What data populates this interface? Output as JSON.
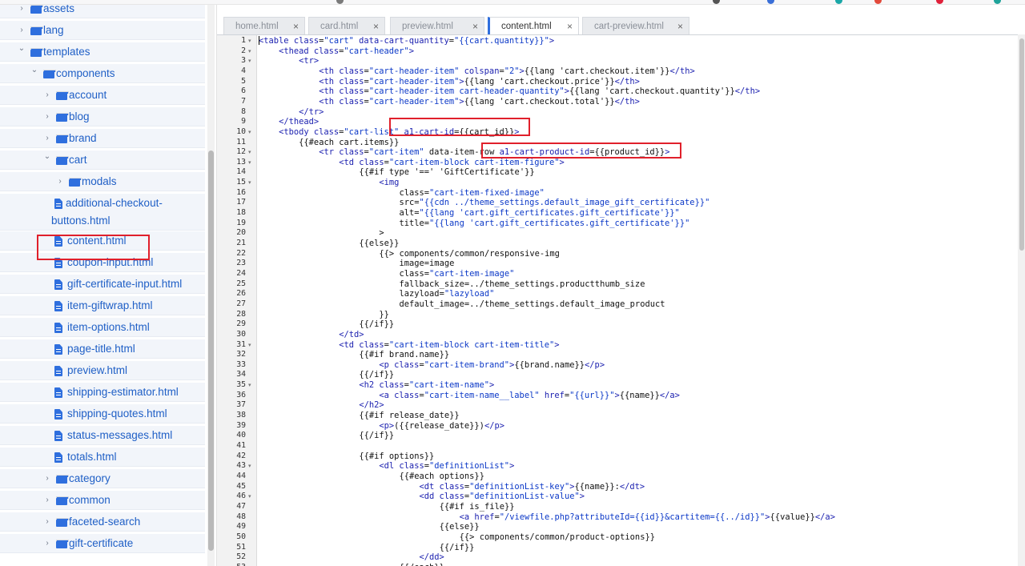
{
  "sidebar": {
    "items": [
      {
        "kind": "folder",
        "label": "assets",
        "expanded": false
      },
      {
        "kind": "folder",
        "label": "lang",
        "expanded": false
      },
      {
        "kind": "folder",
        "label": "templates",
        "expanded": true
      },
      {
        "kind": "folder",
        "label": "components",
        "expanded": true
      },
      {
        "kind": "folder",
        "label": "account",
        "expanded": false
      },
      {
        "kind": "folder",
        "label": "blog",
        "expanded": false
      },
      {
        "kind": "folder",
        "label": "brand",
        "expanded": false
      },
      {
        "kind": "folder",
        "label": "cart",
        "expanded": true
      },
      {
        "kind": "folder",
        "label": "modals",
        "expanded": false
      },
      {
        "kind": "file",
        "label": "additional-checkout-buttons.html"
      },
      {
        "kind": "file",
        "label": "content.html",
        "highlighted": true
      },
      {
        "kind": "file",
        "label": "coupon-input.html"
      },
      {
        "kind": "file",
        "label": "gift-certificate-input.html"
      },
      {
        "kind": "file",
        "label": "item-giftwrap.html"
      },
      {
        "kind": "file",
        "label": "item-options.html"
      },
      {
        "kind": "file",
        "label": "page-title.html"
      },
      {
        "kind": "file",
        "label": "preview.html"
      },
      {
        "kind": "file",
        "label": "shipping-estimator.html"
      },
      {
        "kind": "file",
        "label": "shipping-quotes.html"
      },
      {
        "kind": "file",
        "label": "status-messages.html"
      },
      {
        "kind": "file",
        "label": "totals.html"
      },
      {
        "kind": "folder",
        "label": "category",
        "expanded": false
      },
      {
        "kind": "folder",
        "label": "common",
        "expanded": false
      },
      {
        "kind": "folder",
        "label": "faceted-search",
        "expanded": false
      },
      {
        "kind": "folder",
        "label": "gift-certificate",
        "expanded": false
      }
    ]
  },
  "tabs": [
    {
      "label": "home.html",
      "active": false
    },
    {
      "label": "card.html",
      "active": false
    },
    {
      "label": "preview.html",
      "active": false
    },
    {
      "label": "content.html",
      "active": true
    },
    {
      "label": "cart-preview.html",
      "active": false
    }
  ],
  "tab_close_glyph": "×",
  "editor": {
    "lines": [
      {
        "n": "1",
        "fold": true,
        "text": "<table class=\"cart\" data-cart-quantity=\"{{cart.quantity}}\">"
      },
      {
        "n": "2",
        "fold": true,
        "text": "    <thead class=\"cart-header\">"
      },
      {
        "n": "3",
        "fold": true,
        "text": "        <tr>"
      },
      {
        "n": "4",
        "fold": false,
        "text": "            <th class=\"cart-header-item\" colspan=\"2\">{{lang 'cart.checkout.item'}}</th>"
      },
      {
        "n": "5",
        "fold": false,
        "text": "            <th class=\"cart-header-item\">{{lang 'cart.checkout.price'}}</th>"
      },
      {
        "n": "6",
        "fold": false,
        "text": "            <th class=\"cart-header-item cart-header-quantity\">{{lang 'cart.checkout.quantity'}}</th>"
      },
      {
        "n": "7",
        "fold": false,
        "text": "            <th class=\"cart-header-item\">{{lang 'cart.checkout.total'}}</th>"
      },
      {
        "n": "8",
        "fold": false,
        "text": "        </tr>"
      },
      {
        "n": "9",
        "fold": false,
        "text": "    </thead>"
      },
      {
        "n": "10",
        "fold": true,
        "text": "    <tbody class=\"cart-list\" a1-cart-id={{cart_id}}>"
      },
      {
        "n": "11",
        "fold": false,
        "text": "        {{#each cart.items}}"
      },
      {
        "n": "12",
        "fold": true,
        "text": "            <tr class=\"cart-item\" data-item-row a1-cart-product-id={{product_id}}>"
      },
      {
        "n": "13",
        "fold": true,
        "text": "                <td class=\"cart-item-block cart-item-figure\">"
      },
      {
        "n": "14",
        "fold": false,
        "text": "                    {{#if type '==' 'GiftCertificate'}}"
      },
      {
        "n": "15",
        "fold": true,
        "text": "                        <img"
      },
      {
        "n": "16",
        "fold": false,
        "text": "                            class=\"cart-item-fixed-image\""
      },
      {
        "n": "17",
        "fold": false,
        "text": "                            src=\"{{cdn ../theme_settings.default_image_gift_certificate}}\""
      },
      {
        "n": "18",
        "fold": false,
        "text": "                            alt=\"{{lang 'cart.gift_certificates.gift_certificate'}}\""
      },
      {
        "n": "19",
        "fold": false,
        "text": "                            title=\"{{lang 'cart.gift_certificates.gift_certificate'}}\""
      },
      {
        "n": "20",
        "fold": false,
        "text": "                        >"
      },
      {
        "n": "21",
        "fold": false,
        "text": "                    {{else}}"
      },
      {
        "n": "22",
        "fold": false,
        "text": "                        {{> components/common/responsive-img"
      },
      {
        "n": "23",
        "fold": false,
        "text": "                            image=image"
      },
      {
        "n": "24",
        "fold": false,
        "text": "                            class=\"cart-item-image\""
      },
      {
        "n": "25",
        "fold": false,
        "text": "                            fallback_size=../theme_settings.productthumb_size"
      },
      {
        "n": "26",
        "fold": false,
        "text": "                            lazyload=\"lazyload\""
      },
      {
        "n": "27",
        "fold": false,
        "text": "                            default_image=../theme_settings.default_image_product"
      },
      {
        "n": "28",
        "fold": false,
        "text": "                        }}"
      },
      {
        "n": "29",
        "fold": false,
        "text": "                    {{/if}}"
      },
      {
        "n": "30",
        "fold": false,
        "text": "                </td>"
      },
      {
        "n": "31",
        "fold": true,
        "text": "                <td class=\"cart-item-block cart-item-title\">"
      },
      {
        "n": "32",
        "fold": false,
        "text": "                    {{#if brand.name}}"
      },
      {
        "n": "33",
        "fold": false,
        "text": "                        <p class=\"cart-item-brand\">{{brand.name}}</p>"
      },
      {
        "n": "34",
        "fold": false,
        "text": "                    {{/if}}"
      },
      {
        "n": "35",
        "fold": true,
        "text": "                    <h2 class=\"cart-item-name\">"
      },
      {
        "n": "36",
        "fold": false,
        "text": "                        <a class=\"cart-item-name__label\" href=\"{{url}}\">{{name}}</a>"
      },
      {
        "n": "37",
        "fold": false,
        "text": "                    </h2>"
      },
      {
        "n": "38",
        "fold": false,
        "text": "                    {{#if release_date}}"
      },
      {
        "n": "39",
        "fold": false,
        "text": "                        <p>({{release_date}})</p>"
      },
      {
        "n": "40",
        "fold": false,
        "text": "                    {{/if}}"
      },
      {
        "n": "41",
        "fold": false,
        "text": ""
      },
      {
        "n": "42",
        "fold": false,
        "text": "                    {{#if options}}"
      },
      {
        "n": "43",
        "fold": true,
        "text": "                        <dl class=\"definitionList\">"
      },
      {
        "n": "44",
        "fold": false,
        "text": "                            {{#each options}}"
      },
      {
        "n": "45",
        "fold": false,
        "text": "                                <dt class=\"definitionList-key\">{{name}}:</dt>"
      },
      {
        "n": "46",
        "fold": true,
        "text": "                                <dd class=\"definitionList-value\">"
      },
      {
        "n": "47",
        "fold": false,
        "text": "                                    {{#if is_file}}"
      },
      {
        "n": "48",
        "fold": false,
        "text": "                                        <a href=\"/viewfile.php?attributeId={{id}}&cartitem={{../id}}\">{{value}}</a>"
      },
      {
        "n": "49",
        "fold": false,
        "text": "                                    {{else}}"
      },
      {
        "n": "50",
        "fold": false,
        "text": "                                        {{> components/common/product-options}}"
      },
      {
        "n": "51",
        "fold": false,
        "text": "                                    {{/if}}"
      },
      {
        "n": "52",
        "fold": false,
        "text": "                                </dd>"
      },
      {
        "n": "53",
        "fold": false,
        "text": "                            {{/each}}"
      }
    ]
  },
  "colors": {
    "accent": "#2f6fde",
    "highlight_box": "#e0202b",
    "tag": "#1d22b0",
    "string": "#0b38c7"
  },
  "icons": {
    "folder": "folder-icon",
    "file": "file-icon",
    "chevron_right": "chevron-right-icon",
    "chevron_down": "chevron-down-icon",
    "close": "close-icon"
  }
}
